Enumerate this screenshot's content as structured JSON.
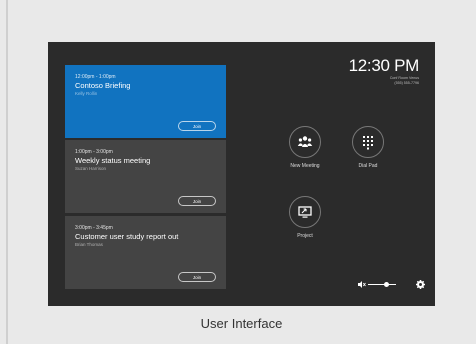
{
  "meetings": [
    {
      "time": "12:00pm - 1:00pm",
      "title": "Contoso Briefing",
      "host": "Kelly Rollin",
      "join_label": "Join",
      "active": true
    },
    {
      "time": "1:00pm - 3:00pm",
      "title": "Weekly status meeting",
      "host": "Suzan Harrison",
      "join_label": "Join",
      "active": false
    },
    {
      "time": "3:00pm - 3:45pm",
      "title": "Customer user study report out",
      "host": "Brian Thomas",
      "join_label": "Join",
      "active": false
    }
  ],
  "clock": {
    "time": "12:30 PM",
    "room_name": "Conf Room Venus",
    "room_phone": "(555) 555-7796"
  },
  "actions": {
    "new_meeting": "New Meeting",
    "dial_pad": "Dial Pad",
    "project": "Project"
  },
  "volume": {
    "level": 0.6
  },
  "caption": "User Interface",
  "colors": {
    "accent": "#1173c0",
    "screen_bg": "#2b2b2b",
    "card_bg": "#444444"
  }
}
